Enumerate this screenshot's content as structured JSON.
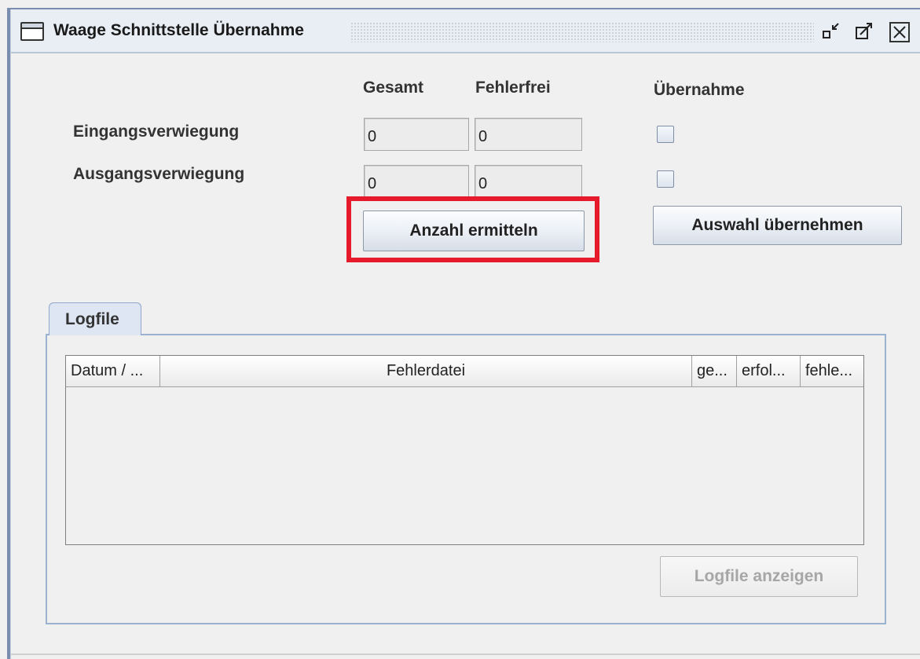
{
  "window": {
    "title": "Waage Schnittstelle Übernahme",
    "minimize_icon": "minimize-icon",
    "maximize_icon": "maximize-icon",
    "close_icon": "close-icon",
    "close_glyph": "☒"
  },
  "columns": {
    "gesamt": "Gesamt",
    "fehlerfrei": "Fehlerfrei",
    "uebernahme": "Übernahme"
  },
  "rows": [
    {
      "label": "Eingangsverwiegung",
      "gesamt": "0",
      "fehlerfrei": "0",
      "checked": false
    },
    {
      "label": "Ausgangsverwiegung",
      "gesamt": "0",
      "fehlerfrei": "0",
      "checked": false
    }
  ],
  "buttons": {
    "anzahl_ermitteln": "Anzahl ermitteln",
    "auswahl_uebernehmen": "Auswahl übernehmen",
    "logfile_anzeigen": "Logfile anzeigen"
  },
  "tabs": [
    {
      "label": "Logfile",
      "selected": true
    }
  ],
  "log_table": {
    "headers": [
      "Datum / ...",
      "Fehlerdatei",
      "ge...",
      "erfol...",
      "fehle..."
    ],
    "rows": []
  },
  "colors": {
    "highlight": "#e51a2a",
    "tab_border": "#9bb2d1"
  }
}
